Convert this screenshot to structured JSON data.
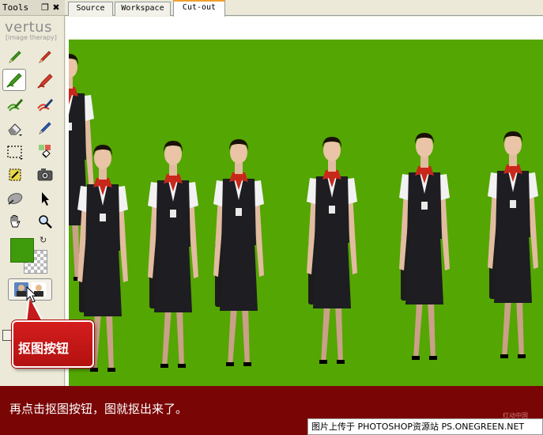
{
  "panel": {
    "title": "Tools",
    "dock_label": "❐",
    "close_label": "✖",
    "logo": "vertus",
    "logo_sub": "[image therapy]"
  },
  "tabs": [
    {
      "label": "Source",
      "active": false
    },
    {
      "label": "Workspace",
      "active": false
    },
    {
      "label": "Cut-out",
      "active": true
    }
  ],
  "tools": [
    {
      "name": "green-pencil-icon",
      "active": false
    },
    {
      "name": "red-pencil-icon",
      "active": false
    },
    {
      "name": "green-marker-icon",
      "active": true
    },
    {
      "name": "red-marker-icon",
      "active": false
    },
    {
      "name": "green-hair-brush-icon",
      "active": false
    },
    {
      "name": "red-hair-brush-icon",
      "active": false
    },
    {
      "name": "eraser-icon",
      "active": false
    },
    {
      "name": "blue-pen-icon",
      "active": false
    },
    {
      "name": "selection-rectangle-icon",
      "active": false
    },
    {
      "name": "fill-bucket-icon",
      "active": false
    },
    {
      "name": "magic-wand-icon",
      "active": false
    },
    {
      "name": "camera-icon",
      "active": false
    },
    {
      "name": "smudge-icon",
      "active": false
    },
    {
      "name": "arrow-pointer-icon",
      "active": false
    },
    {
      "name": "hand-pan-icon",
      "active": false
    },
    {
      "name": "zoom-magnifier-icon",
      "active": false
    }
  ],
  "colors": {
    "foreground": "#3f9b0b",
    "canvas_green": "#54a602",
    "banner": "#7a0505",
    "callout": "#d51d1d",
    "active_tab_accent": "#f0a030"
  },
  "callout": {
    "text": "抠图按钮"
  },
  "banner": {
    "text": "再点击抠图按钮，图就抠出来了。"
  },
  "credit": {
    "text": "图片上传于 PHOTOSHOP资源站  PS.ONEGREEN.NET"
  },
  "watermark": {
    "text": "红动中国"
  }
}
